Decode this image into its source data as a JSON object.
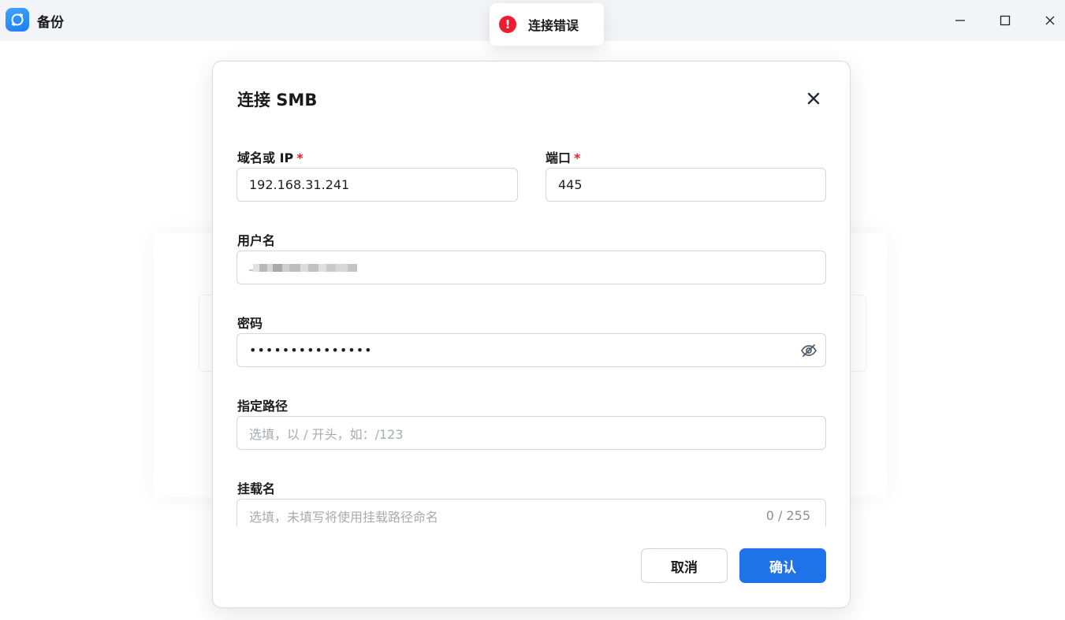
{
  "window": {
    "title": "备份",
    "minimize_icon": "minimize-icon",
    "maximize_icon": "maximize-icon",
    "close_icon": "close-icon"
  },
  "toast": {
    "icon": "error-icon",
    "message": "连接错误",
    "color": "#ef1c2f"
  },
  "dialog": {
    "title": "连接 SMB",
    "fields": {
      "host": {
        "label": "域名或 IP",
        "required": "*",
        "value": "192.168.31.241"
      },
      "port": {
        "label": "端口",
        "required": "*",
        "value": "445"
      },
      "username": {
        "label": "用户名",
        "value": "[redacted]"
      },
      "password": {
        "label": "密码",
        "value": "•••••••••••••••",
        "toggle_icon": "eye-off-icon"
      },
      "path": {
        "label": "指定路径",
        "placeholder": "选填，以 / 开头，如：/123"
      },
      "mount_name": {
        "label": "挂载名",
        "placeholder": "选填，未填写将使用挂载路径命名",
        "counter": "0 / 255"
      }
    },
    "cancel_label": "取消",
    "confirm_label": "确认",
    "accent_color": "#1e73e8"
  }
}
